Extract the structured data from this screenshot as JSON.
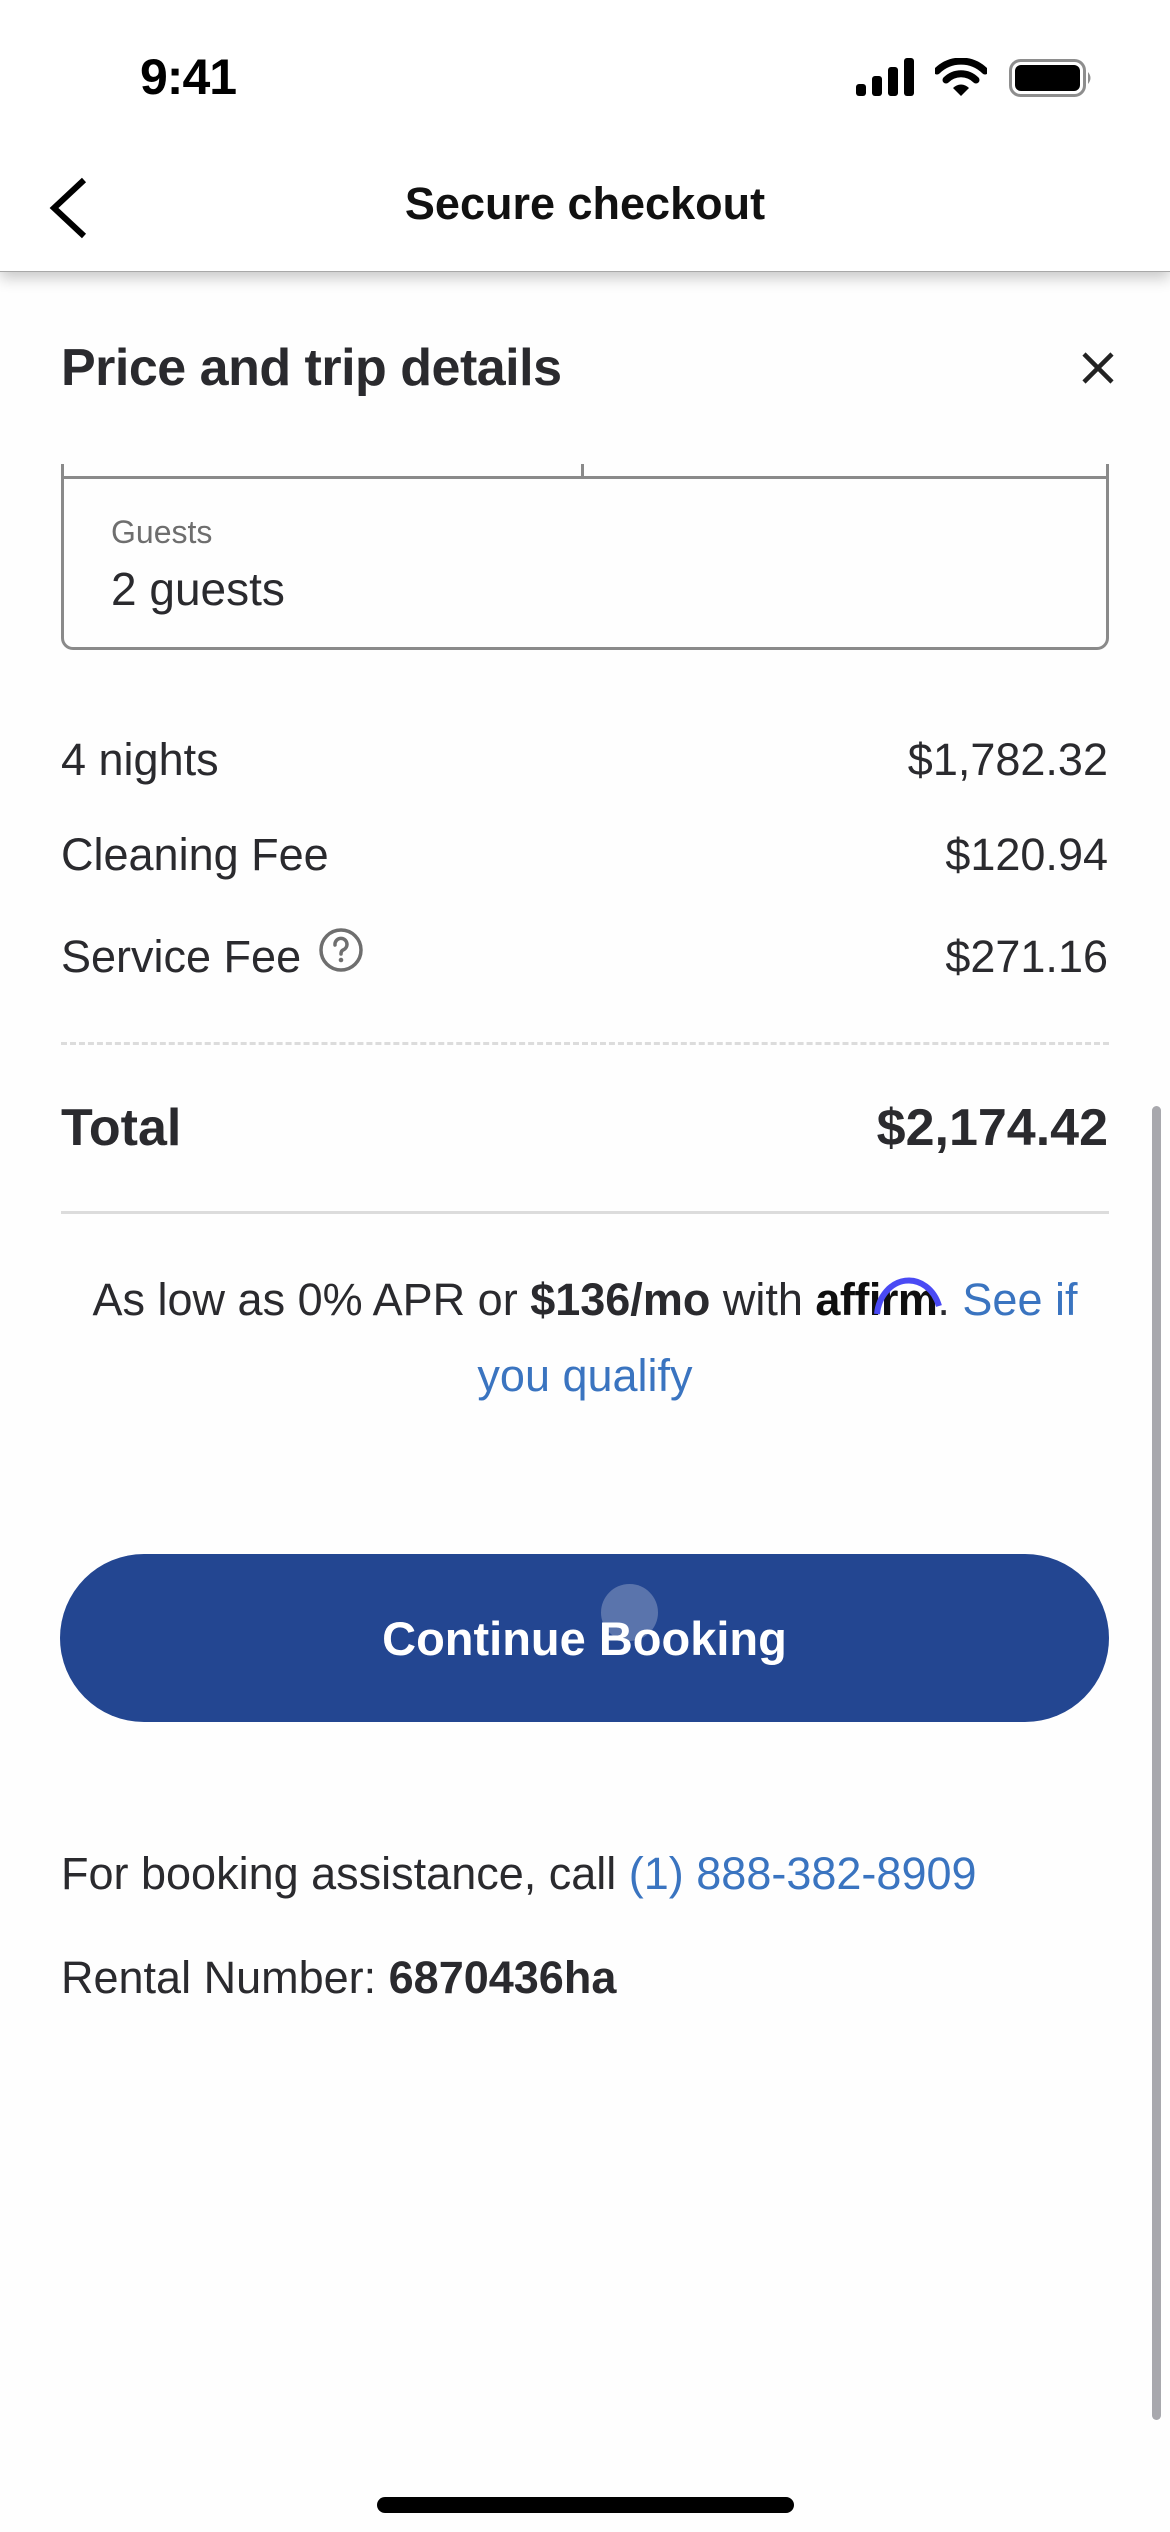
{
  "status_bar": {
    "time": "9:41",
    "icons": [
      "cellular-signal-icon",
      "wifi-icon",
      "battery-icon"
    ]
  },
  "header": {
    "back_icon": "chevron-left-icon",
    "title": "Secure checkout"
  },
  "sheet": {
    "title": "Price and trip details",
    "close_icon": "close-icon",
    "guests": {
      "label": "Guests",
      "value": "2 guests"
    },
    "price_rows": [
      {
        "label": "4 nights",
        "value": "$1,782.32"
      },
      {
        "label": "Cleaning Fee",
        "value": "$120.94"
      },
      {
        "label": "Service Fee",
        "value": "$271.16",
        "info_icon": "help-circle-icon"
      }
    ],
    "total": {
      "label": "Total",
      "value": "$2,174.42"
    },
    "financing": {
      "prefix": "As low as 0% APR or ",
      "monthly": "$136/mo",
      "middle": " with ",
      "brand": "affirm",
      "suffix": ". ",
      "link": "See if you qualify",
      "brand_color": "#4a4af4"
    },
    "cta": {
      "label": "Continue Booking",
      "color": "#234691"
    },
    "assistance": {
      "text": "For booking assistance, call ",
      "phone": "(1) 888-382-8909"
    },
    "rental": {
      "label": "Rental Number: ",
      "value": "6870436ha"
    }
  },
  "colors": {
    "link": "#3a74c0",
    "text": "#2a2a2e"
  }
}
